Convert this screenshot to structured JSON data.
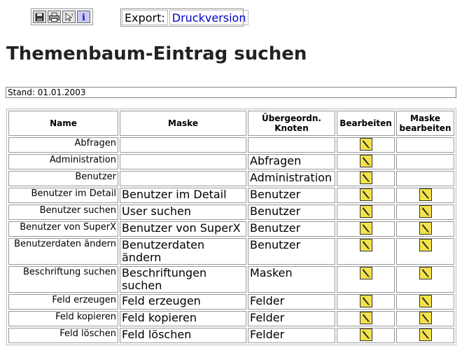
{
  "toolbar": {
    "items": [
      {
        "icon": "save-icon"
      },
      {
        "icon": "print-icon"
      },
      {
        "icon": "help-icon"
      },
      {
        "icon": "info-icon"
      }
    ]
  },
  "export": {
    "label": "Export:",
    "link": "Druckversion"
  },
  "page_title": "Themenbaum-Eintrag suchen",
  "stand": "Stand: 01.01.2003",
  "table": {
    "headers": {
      "name": "Name",
      "maske": "Maske",
      "parent": "Übergeordn. Knoten",
      "edit": "Bearbeiten",
      "edit_mask": "Maske bearbeiten"
    },
    "rows": [
      {
        "name": "Abfragen",
        "maske": "",
        "parent": "",
        "mask_edit": false
      },
      {
        "name": "Administration",
        "maske": "",
        "parent": "Abfragen",
        "mask_edit": false
      },
      {
        "name": "Benutzer",
        "maske": "",
        "parent": "Administration",
        "mask_edit": false
      },
      {
        "name": "Benutzer im Detail",
        "maske": "Benutzer im Detail",
        "parent": "Benutzer",
        "mask_edit": true
      },
      {
        "name": "Benutzer suchen",
        "maske": "User suchen",
        "parent": "Benutzer",
        "mask_edit": true
      },
      {
        "name": "Benutzer von SuperX",
        "maske": "Benutzer von SuperX",
        "parent": "Benutzer",
        "mask_edit": true
      },
      {
        "name": "Benutzerdaten ändern",
        "maske": "Benutzerdaten ändern",
        "parent": "Benutzer",
        "mask_edit": true
      },
      {
        "name": "Beschriftung suchen",
        "maske": "Beschriftungen suchen",
        "parent": "Masken",
        "mask_edit": true
      },
      {
        "name": "Feld erzeugen",
        "maske": "Feld erzeugen",
        "parent": "Felder",
        "mask_edit": true
      },
      {
        "name": "Feld kopieren",
        "maske": "Feld kopieren",
        "parent": "Felder",
        "mask_edit": true
      },
      {
        "name": "Feld löschen",
        "maske": "Feld löschen",
        "parent": "Felder",
        "mask_edit": true
      }
    ]
  },
  "colors": {
    "link": "#0000cc",
    "edit_icon_bg": "#f3e24a",
    "title": "#222222"
  }
}
